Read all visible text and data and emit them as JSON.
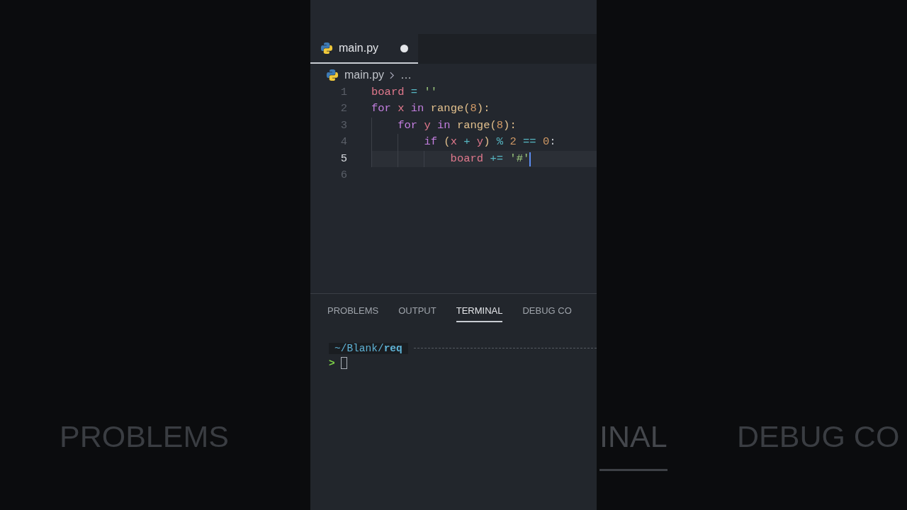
{
  "backdrop": {
    "tabs": [
      {
        "label": "PROBLEMS",
        "selected": false
      },
      {
        "label": "INAL",
        "selected": true
      },
      {
        "label": "DEBUG CO",
        "selected": false
      }
    ]
  },
  "editor": {
    "tab": {
      "label": "main.py",
      "modified": true,
      "selected": true
    },
    "breadcrumb": {
      "file": "main.py",
      "more": "…"
    },
    "lines": [
      {
        "number": "1",
        "current": false,
        "tokens": [
          {
            "text": "board",
            "kind": "var"
          },
          {
            "text": " =",
            "kind": "op"
          },
          {
            "text": " ''",
            "kind": "string"
          }
        ]
      },
      {
        "number": "2",
        "current": false,
        "tokens": [
          {
            "text": "for",
            "kind": "keyword"
          },
          {
            "text": " x",
            "kind": "var"
          },
          {
            "text": " in",
            "kind": "keyword"
          },
          {
            "text": " range",
            "kind": "func"
          },
          {
            "text": "(",
            "kind": "paren"
          },
          {
            "text": "8",
            "kind": "number"
          },
          {
            "text": "):",
            "kind": "paren"
          }
        ]
      },
      {
        "number": "3",
        "current": false,
        "tokens": [
          {
            "text": "    for",
            "kind": "keyword"
          },
          {
            "text": " y",
            "kind": "var"
          },
          {
            "text": " in",
            "kind": "keyword"
          },
          {
            "text": " range",
            "kind": "func"
          },
          {
            "text": "(",
            "kind": "paren"
          },
          {
            "text": "8",
            "kind": "number"
          },
          {
            "text": "):",
            "kind": "paren"
          }
        ]
      },
      {
        "number": "4",
        "current": false,
        "tokens": [
          {
            "text": "        if",
            "kind": "keyword"
          },
          {
            "text": " (",
            "kind": "paren"
          },
          {
            "text": "x",
            "kind": "var"
          },
          {
            "text": " +",
            "kind": "op"
          },
          {
            "text": " y",
            "kind": "var"
          },
          {
            "text": ")",
            "kind": "paren"
          },
          {
            "text": " %",
            "kind": "op"
          },
          {
            "text": " 2",
            "kind": "number"
          },
          {
            "text": " ==",
            "kind": "op"
          },
          {
            "text": " 0",
            "kind": "number"
          },
          {
            "text": ":",
            "kind": "plain"
          }
        ]
      },
      {
        "number": "5",
        "current": true,
        "tokens": [
          {
            "text": "            board",
            "kind": "var"
          },
          {
            "text": " +=",
            "kind": "op"
          },
          {
            "text": " '#'",
            "kind": "string"
          }
        ]
      },
      {
        "number": "6",
        "current": false
      }
    ]
  },
  "panel": {
    "tabs": [
      {
        "label": "PROBLEMS",
        "selected": false
      },
      {
        "label": "OUTPUT",
        "selected": false
      },
      {
        "label": "TERMINAL",
        "selected": true
      },
      {
        "label": "DEBUG CO",
        "selected": false
      }
    ],
    "terminal": {
      "path": "~/Blank/**req**",
      "prompt": ">"
    }
  }
}
